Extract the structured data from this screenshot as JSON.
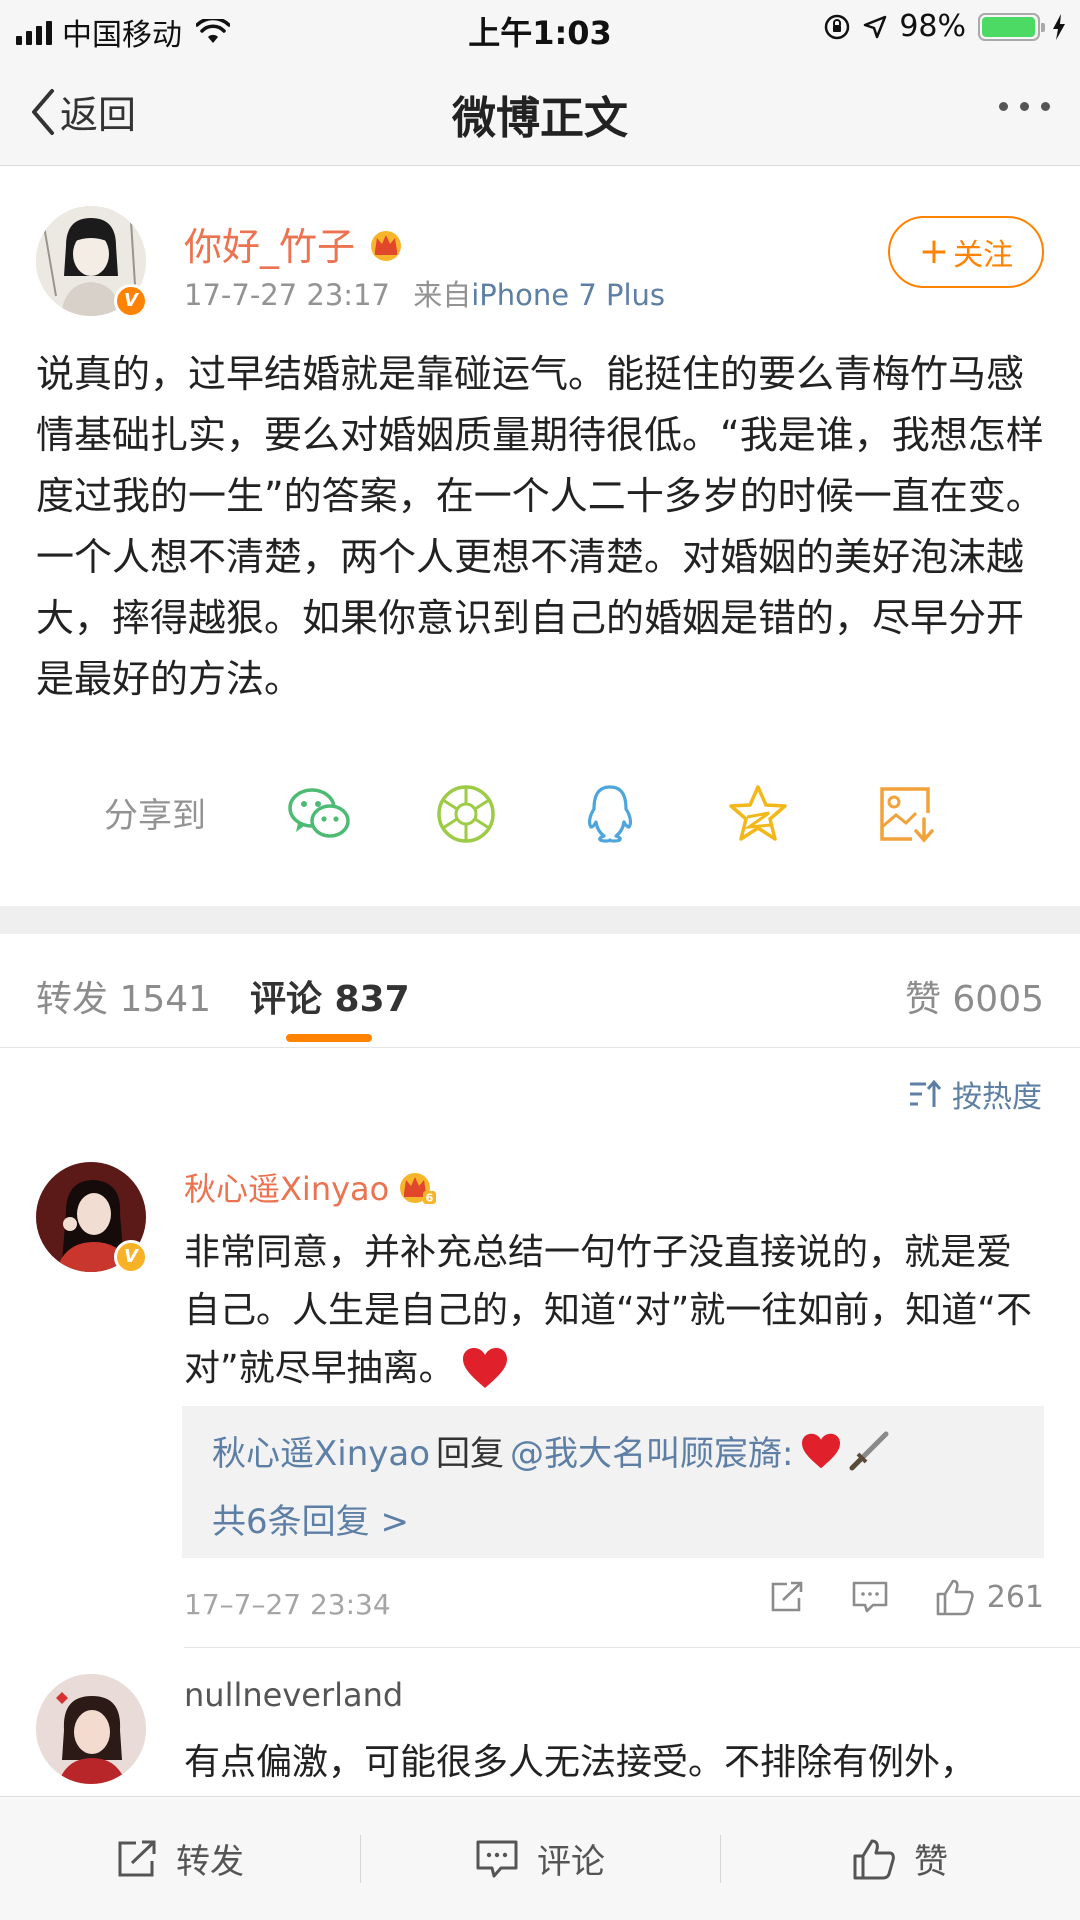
{
  "status_bar": {
    "carrier": "中国移动",
    "time": "上午1:03",
    "battery_pct": "98%",
    "battery_level": 0.98
  },
  "nav": {
    "back_label": "返回",
    "title": "微博正文"
  },
  "post": {
    "author": "你好_竹子",
    "time": "17-7-27 23:17",
    "source_prefix": "来自",
    "source": "iPhone 7 Plus",
    "follow_label": "关注",
    "text": "说真的，过早结婚就是靠碰运气。能挺住的要么青梅竹马感情基础扎实，要么对婚姻质量期待很低。“我是谁，我想怎样度过我的一生”的答案，在一个人二十多岁的时候一直在变。一个人想不清楚，两个人更想不清楚。对婚姻的美好泡沫越大，摔得越狠。如果你意识到自己的婚姻是错的，尽早分开是最好的方法。",
    "share_label": "分享到",
    "share_icons": [
      "wechat-icon",
      "moments-icon",
      "qq-icon",
      "qzone-icon",
      "save-image-icon"
    ],
    "colors": {
      "name": "#eb7350",
      "link": "#5d7fa5",
      "accent": "#ff8200"
    }
  },
  "tabs": {
    "repost": "转发 1541",
    "comments": "评论 837",
    "likes": "赞 6005"
  },
  "sort_label": "按热度",
  "comments": [
    {
      "name": "秋心遥Xinyao",
      "crown_level": "6",
      "text": "非常同意，并补充总结一句竹子没直接说的，就是爱自己。人生是自己的，知道“对”就一往如前，知道“不对”就尽早抽离。",
      "reply_author": "秋心遥Xinyao",
      "reply_mid": "回复",
      "reply_target": "@我大名叫顾宸旖:",
      "reply_more": "共6条回复 >",
      "time": "17–7–27 23:34",
      "likes": "261"
    },
    {
      "name": "nullneverland",
      "text": "有点偏激，可能很多人无法接受。不排除有例外，"
    }
  ],
  "bottom_bar": {
    "repost": "转发",
    "comment": "评论",
    "like": "赞"
  }
}
